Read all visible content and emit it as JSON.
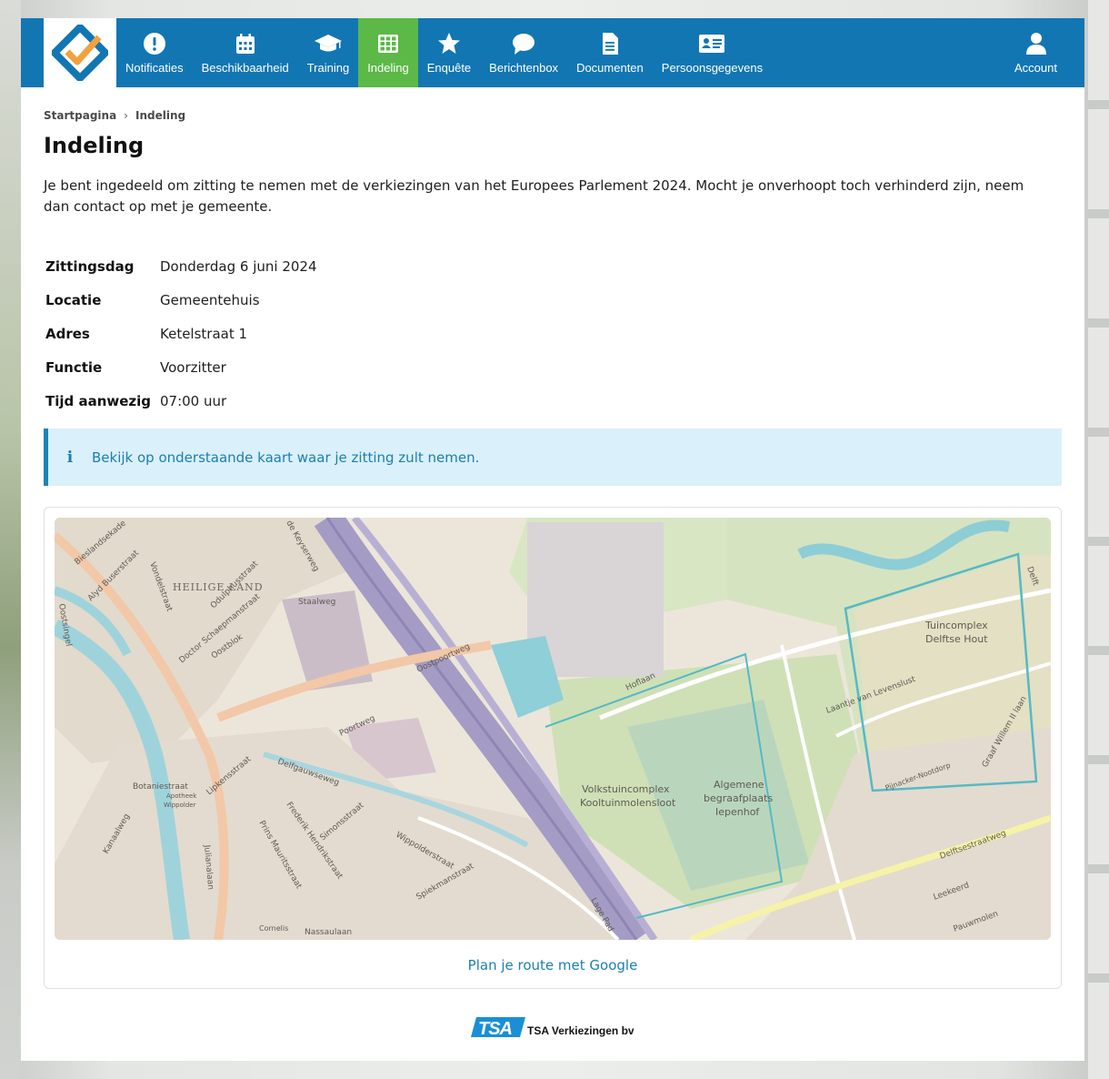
{
  "nav": {
    "items": [
      {
        "label": "Notificaties",
        "icon": "exclamation-circle-icon"
      },
      {
        "label": "Beschikbaarheid",
        "icon": "calendar-icon"
      },
      {
        "label": "Training",
        "icon": "graduation-cap-icon"
      },
      {
        "label": "Indeling",
        "icon": "grid-icon",
        "active": true
      },
      {
        "label": "Enquête",
        "icon": "star-icon"
      },
      {
        "label": "Berichtenbox",
        "icon": "chat-bubble-icon"
      },
      {
        "label": "Documenten",
        "icon": "document-icon"
      },
      {
        "label": "Persoonsgegevens",
        "icon": "id-card-icon"
      }
    ],
    "account": {
      "label": "Account",
      "icon": "user-icon"
    },
    "colors": {
      "bar": "#1276b3",
      "active": "#5cb847"
    }
  },
  "breadcrumb": {
    "home": "Startpagina",
    "current": "Indeling"
  },
  "page": {
    "title": "Indeling",
    "intro": "Je bent ingedeeld om zitting te nemen met de verkiezingen van het Europees Parlement 2024. Mocht je onverhoopt toch verhinderd zijn, neem dan contact op met je gemeente."
  },
  "details": [
    {
      "key": "Zittingsdag",
      "value": "Donderdag 6 juni 2024"
    },
    {
      "key": "Locatie",
      "value": "Gemeentehuis"
    },
    {
      "key": "Adres",
      "value": "Ketelstraat 1"
    },
    {
      "key": "Functie",
      "value": "Voorzitter"
    },
    {
      "key": "Tijd aanwezig",
      "value": "07:00 uur"
    }
  ],
  "alert": {
    "icon": "info-icon",
    "text": "Bekijk op onderstaande kaart waar je zitting zult nemen."
  },
  "map": {
    "labels": {
      "heilige_land": "HEILIGE LAND",
      "bieslandsekade": "Bieslandsekade",
      "alyd": "Alyd Buserstraat",
      "vondelstraat": "Vondelstraat",
      "odulphus": "Odulphusstraat",
      "schaepman": "Doctor Schaepmanstraat",
      "keyserweg": "de Keyserweg",
      "staalweg": "Staalweg",
      "oostblok": "Oostblok",
      "oostpoortweg": "Oostpoortweg",
      "poortweg": "Poortweg",
      "hoflaan": "Hoflaan",
      "levenslust": "Laantje van Levenslust",
      "tuincomplex1": "Tuincomplex",
      "tuincomplex2": "Delftse Hout",
      "volkstuin1": "Volkstuincomplex",
      "volkstuin2": "Kooltuinmolensloot",
      "begraaf1": "Algemene",
      "begraaf2": "begraafplaats",
      "begraaf3": "Iepenhof",
      "botanie": "Botaniestraat",
      "apotheek1": "Apotheek",
      "apotheek2": "Wippolder",
      "kanaalweg": "Kanaalweg",
      "lipkens": "Lipkensstraat",
      "frederik": "Frederik Hendrikstraat",
      "prins": "Prins Mauritsstraat",
      "simons": "Simonsstraat",
      "julianalaan": "Julianalaan",
      "delfgauwseweg": "Delfgauwseweg",
      "wippolder": "Wippolderstraat",
      "spiekman": "Spiekmanstraat",
      "nassaulaan": "Nassaulaan",
      "cornelis": "Cornelis",
      "lagepad": "Lage Pad",
      "delftsestraatweg": "Delftsestraatweg",
      "leekeerd": "Leekeerd",
      "pauwmolen": "Pauwmolen",
      "pijnacker": "Pijnacker-Nootdorp",
      "gravewillem": "Graaf Willem II laan",
      "oostsingel": "Oostsingel",
      "delft": "Delft"
    }
  },
  "route_link": "Plan je route met Google",
  "footer": {
    "logo_text": "TSA",
    "brand": "TSA Verkiezingen bv"
  }
}
